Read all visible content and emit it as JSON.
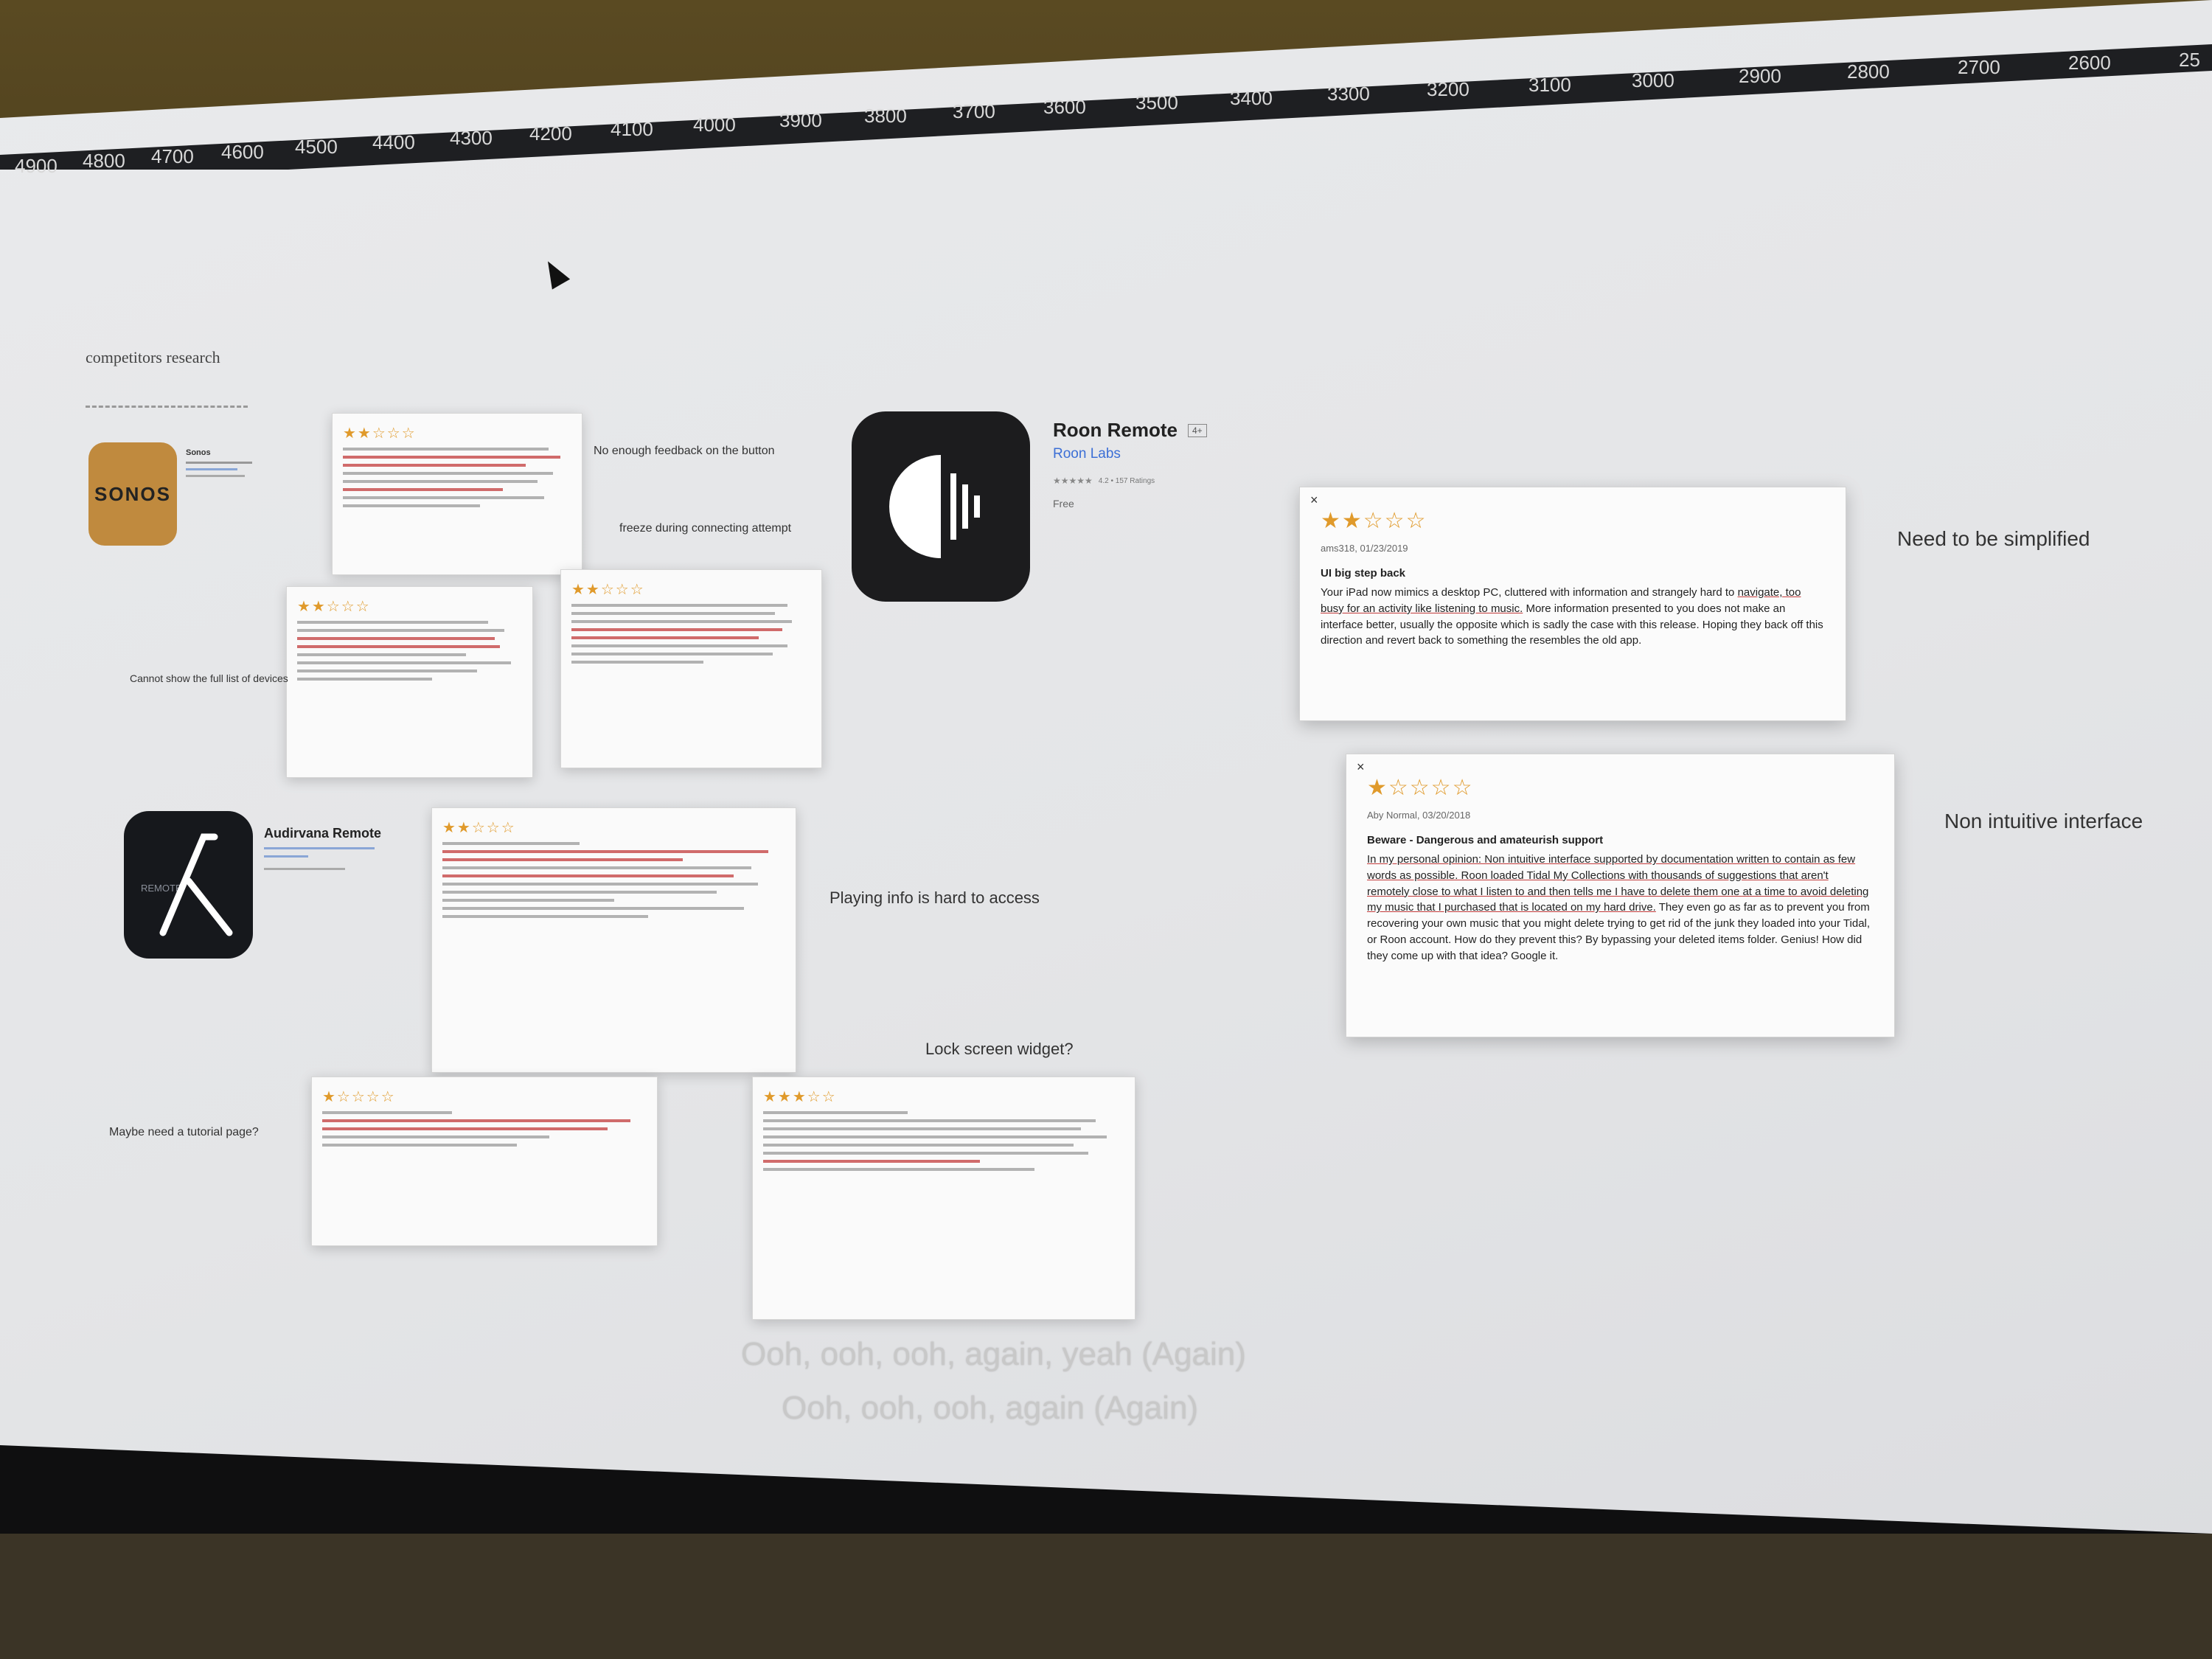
{
  "ruler": {
    "labels": [
      "4900",
      "4800",
      "4700",
      "4600",
      "4500",
      "4400",
      "4300",
      "4200",
      "4100",
      "4000",
      "3900",
      "3800",
      "3700",
      "3600",
      "3500",
      "3400",
      "3300",
      "3200",
      "3100",
      "3000",
      "2900",
      "2800",
      "2700",
      "2600",
      "25"
    ]
  },
  "canvas": {
    "section_title": "competitors research"
  },
  "sonos": {
    "logo_text": "SONOS",
    "app_name": "Sonos"
  },
  "roon": {
    "app_name": "Roon Remote",
    "age_badge": "4+",
    "developer": "Roon Labs",
    "rating_text": "4.2 • 157 Ratings",
    "price": "Free"
  },
  "audirvana": {
    "app_name": "Audirvana Remote",
    "icon_text": "REMOTE"
  },
  "notes": {
    "sonos_feedback": "No enough feedback on the button",
    "sonos_freeze": "freeze during connecting attempt",
    "sonos_devices": "Cannot show the full list of devices",
    "audirvana_playing": "Playing info is hard to access",
    "audirvana_widget": "Lock screen widget?",
    "audirvana_tutorial": "Maybe need a tutorial page?",
    "roon_simplified": "Need to be simplified",
    "roon_intuitive": "Non intuitive interface"
  },
  "roon_reviews": [
    {
      "stars": "★★☆☆☆",
      "meta": "ams318, 01/23/2019",
      "title": "UI big step back",
      "body_part1": "Your iPad now mimics a desktop PC, cluttered with information and strangely hard to ",
      "body_underline": "navigate, too busy for an activity like listening to music.",
      "body_part2": " More information presented to you does not make an interface better, usually the opposite which is sadly the case with this release. Hoping they back off this direction and revert back to something the resembles the old app."
    },
    {
      "stars": "★☆☆☆☆",
      "meta": "Aby Normal, 03/20/2018",
      "title": "Beware - Dangerous and amateurish support",
      "body_underline": "In my personal opinion: Non intuitive interface supported by documentation written to contain as few words as possible. Roon loaded Tidal My Collections with thousands of suggestions that aren't remotely close to what I listen to and then tells me I have to delete them one at a time to avoid deleting my music that I purchased that is located on my hard drive.",
      "body_part2": " They even go as far as to prevent you from recovering your own music that you might delete trying to get rid of the junk they loaded into your Tidal, or Roon account. How do they prevent this? By bypassing your deleted items folder. Genius! How did they come up with that idea? Google it."
    }
  ],
  "subtitles": {
    "line1": "Ooh, ooh, ooh, again, yeah (Again)",
    "line2": "Ooh, ooh, ooh, again (Again)"
  },
  "colors": {
    "star": "#e09a2b",
    "underline": "#c23b3b",
    "sonos_brand": "#c08a3e"
  }
}
